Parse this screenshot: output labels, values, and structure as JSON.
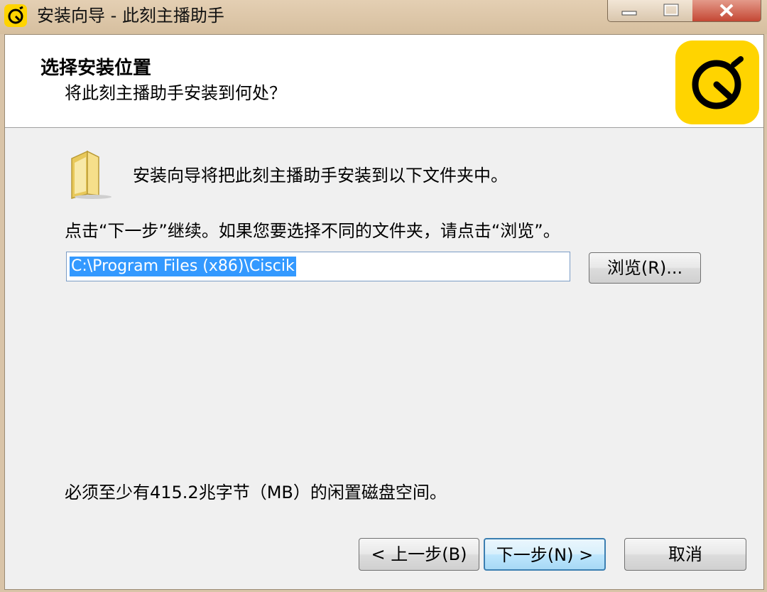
{
  "window": {
    "title": "安装向导 - 此刻主播助手",
    "controls": [
      "minimize-icon",
      "maximize-icon",
      "close-icon"
    ]
  },
  "header": {
    "title": "选择安装位置",
    "subtitle": "将此刻主播助手安装到何处？",
    "logo_icon": "clock-logo-icon"
  },
  "body": {
    "intro": "安装向导将把此刻主播助手安装到以下文件夹中。",
    "instruction": "点击“下一步”继续。如果您要选择不同的文件夹，请点击“浏览”。",
    "path_value": "C:\\Program Files (x86)\\Ciscik",
    "browse_label": "浏览(R)...",
    "disk_space": "必须至少有415.2兆字节（MB）的闲置磁盘空间。"
  },
  "footer": {
    "back_label": "< 上一步(B)",
    "next_label": "下一步(N) >",
    "cancel_label": "取消"
  },
  "colors": {
    "brand_yellow": "#ffd400",
    "selection": "#3399ff",
    "default_button_border": "#3c7fb1"
  }
}
